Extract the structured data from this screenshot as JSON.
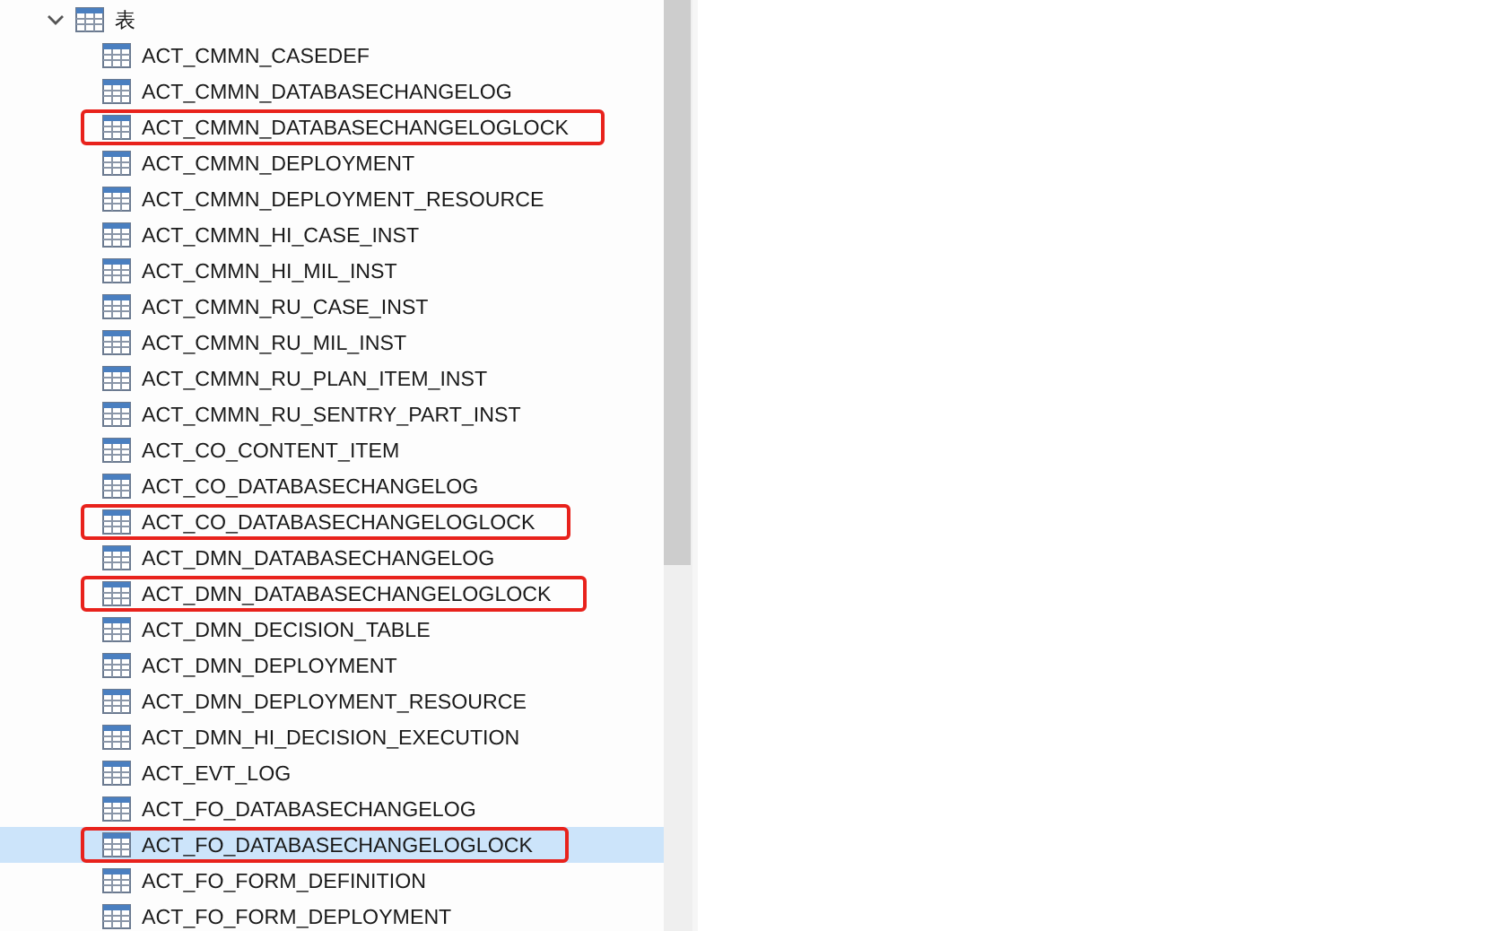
{
  "tree": {
    "label": "表",
    "expanded": true,
    "children": [
      {
        "label": "ACT_CMMN_CASEDEF",
        "selected": false,
        "highlighted": false
      },
      {
        "label": "ACT_CMMN_DATABASECHANGELOG",
        "selected": false,
        "highlighted": false
      },
      {
        "label": "ACT_CMMN_DATABASECHANGELOGLOCK",
        "selected": false,
        "highlighted": true
      },
      {
        "label": "ACT_CMMN_DEPLOYMENT",
        "selected": false,
        "highlighted": false
      },
      {
        "label": "ACT_CMMN_DEPLOYMENT_RESOURCE",
        "selected": false,
        "highlighted": false
      },
      {
        "label": "ACT_CMMN_HI_CASE_INST",
        "selected": false,
        "highlighted": false
      },
      {
        "label": "ACT_CMMN_HI_MIL_INST",
        "selected": false,
        "highlighted": false
      },
      {
        "label": "ACT_CMMN_RU_CASE_INST",
        "selected": false,
        "highlighted": false
      },
      {
        "label": "ACT_CMMN_RU_MIL_INST",
        "selected": false,
        "highlighted": false
      },
      {
        "label": "ACT_CMMN_RU_PLAN_ITEM_INST",
        "selected": false,
        "highlighted": false
      },
      {
        "label": "ACT_CMMN_RU_SENTRY_PART_INST",
        "selected": false,
        "highlighted": false
      },
      {
        "label": "ACT_CO_CONTENT_ITEM",
        "selected": false,
        "highlighted": false
      },
      {
        "label": "ACT_CO_DATABASECHANGELOG",
        "selected": false,
        "highlighted": false
      },
      {
        "label": "ACT_CO_DATABASECHANGELOGLOCK",
        "selected": false,
        "highlighted": true
      },
      {
        "label": "ACT_DMN_DATABASECHANGELOG",
        "selected": false,
        "highlighted": false
      },
      {
        "label": "ACT_DMN_DATABASECHANGELOGLOCK",
        "selected": false,
        "highlighted": true
      },
      {
        "label": "ACT_DMN_DECISION_TABLE",
        "selected": false,
        "highlighted": false
      },
      {
        "label": "ACT_DMN_DEPLOYMENT",
        "selected": false,
        "highlighted": false
      },
      {
        "label": "ACT_DMN_DEPLOYMENT_RESOURCE",
        "selected": false,
        "highlighted": false
      },
      {
        "label": "ACT_DMN_HI_DECISION_EXECUTION",
        "selected": false,
        "highlighted": false
      },
      {
        "label": "ACT_EVT_LOG",
        "selected": false,
        "highlighted": false
      },
      {
        "label": "ACT_FO_DATABASECHANGELOG",
        "selected": false,
        "highlighted": false
      },
      {
        "label": "ACT_FO_DATABASECHANGELOGLOCK",
        "selected": true,
        "highlighted": true
      },
      {
        "label": "ACT_FO_FORM_DEFINITION",
        "selected": false,
        "highlighted": false
      },
      {
        "label": "ACT_FO_FORM_DEPLOYMENT",
        "selected": false,
        "highlighted": false
      }
    ]
  }
}
